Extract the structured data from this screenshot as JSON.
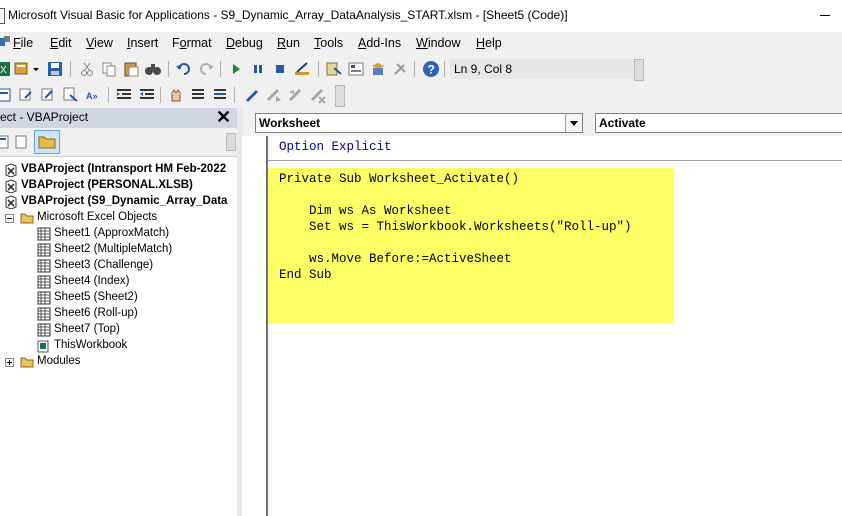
{
  "window": {
    "title": "Microsoft Visual Basic for Applications - S9_Dynamic_Array_DataAnalysis_START.xlsm - [Sheet5 (Code)]"
  },
  "menu": [
    {
      "label": "File",
      "u": "F"
    },
    {
      "label": "Edit",
      "u": "E"
    },
    {
      "label": "View",
      "u": "V"
    },
    {
      "label": "Insert",
      "u": "I"
    },
    {
      "label": "Format",
      "u": "o"
    },
    {
      "label": "Debug",
      "u": "D"
    },
    {
      "label": "Run",
      "u": "R"
    },
    {
      "label": "Tools",
      "u": "T"
    },
    {
      "label": "Add-Ins",
      "u": "A"
    },
    {
      "label": "Window",
      "u": "W"
    },
    {
      "label": "Help",
      "u": "H"
    }
  ],
  "toolbar": {
    "position": "Ln 9, Col 8"
  },
  "project_panel": {
    "title": "ect - VBAProject",
    "close": "✕",
    "tree": [
      {
        "label": "VBAProject (Intransport HM Feb-2022",
        "bold": true,
        "level": 0,
        "icon": "vbaproject-icon"
      },
      {
        "label": "VBAProject (PERSONAL.XLSB)",
        "bold": true,
        "level": 0,
        "icon": "vbaproject-icon"
      },
      {
        "label": "VBAProject (S9_Dynamic_Array_Data",
        "bold": true,
        "level": 0,
        "icon": "vbaproject-icon"
      },
      {
        "label": "Microsoft Excel Objects",
        "bold": false,
        "level": 1,
        "icon": "folder-open-icon"
      },
      {
        "label": "Sheet1 (ApproxMatch)",
        "bold": false,
        "level": 2,
        "icon": "sheet-icon"
      },
      {
        "label": "Sheet2 (MultipleMatch)",
        "bold": false,
        "level": 2,
        "icon": "sheet-icon"
      },
      {
        "label": "Sheet3 (Challenge)",
        "bold": false,
        "level": 2,
        "icon": "sheet-icon"
      },
      {
        "label": "Sheet4 (Index)",
        "bold": false,
        "level": 2,
        "icon": "sheet-icon"
      },
      {
        "label": "Sheet5 (Sheet2)",
        "bold": false,
        "level": 2,
        "icon": "sheet-icon"
      },
      {
        "label": "Sheet6 (Roll-up)",
        "bold": false,
        "level": 2,
        "icon": "sheet-icon"
      },
      {
        "label": "Sheet7 (Top)",
        "bold": false,
        "level": 2,
        "icon": "sheet-icon"
      },
      {
        "label": "ThisWorkbook",
        "bold": false,
        "level": 2,
        "icon": "workbook-icon"
      },
      {
        "label": "Modules",
        "bold": false,
        "level": 1,
        "icon": "folder-icon"
      }
    ]
  },
  "code_window": {
    "object_combo": "Worksheet",
    "procedure_combo": "Activate",
    "lines": [
      {
        "text": "Option Explicit",
        "kw": true
      },
      {
        "text": "Private Sub Worksheet_Activate()",
        "kw": false
      },
      {
        "text": "",
        "kw": false
      },
      {
        "text": "    Dim ws As Worksheet",
        "kw": false
      },
      {
        "text": "    Set ws = ThisWorkbook.Worksheets(\"Roll-up\")",
        "kw": false
      },
      {
        "text": "",
        "kw": false
      },
      {
        "text": "    ws.Move Before:=ActiveSheet",
        "kw": false
      },
      {
        "text": "End Sub",
        "kw": false
      }
    ],
    "highlight_color": "#ffff66"
  },
  "colors": {
    "keyword": "#00008b",
    "panel_title": "#cfd6df",
    "chrome": "#f0f0f0"
  }
}
